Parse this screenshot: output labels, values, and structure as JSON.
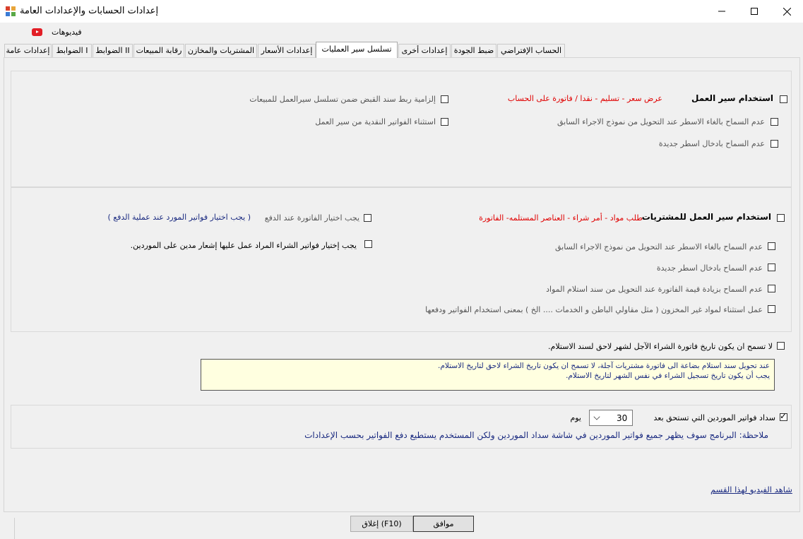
{
  "window": {
    "title": "إعدادات الحسابات والإعدادات العامة",
    "minimize_glyph": "—",
    "maximize_glyph": "☐",
    "close_glyph": "✕"
  },
  "videos_label": "فيديوهات",
  "tabs": [
    "إعدادات عامة",
    "الضوابط I",
    "الضوابط II",
    "رقابة المبيعات",
    "المشتريات والمخازن",
    "إعدادات الأسعار",
    "تسلسل سير العمليات",
    "إعدادات أخرى",
    "ضبط الجودة",
    "الحساب الإفتراضي"
  ],
  "active_tab": "تسلسل سير العمليات",
  "sales_workflow": {
    "use_workflow_label": "استخدام سير العمل",
    "sequence_text": "عرض سعر - تسليم - نقدا / فاتورة على الحساب",
    "no_cancel_lines_label": "عدم السماح بالغاء الاسطر عند التحويل من نموذج الاجراء السابق",
    "no_new_lines_label": "عدم السماح بادخال اسطر جديدة",
    "mandatory_receipt_label": "إلزامية ربط سند القبض ضمن تسلسل سيرالعمل للمبيعات",
    "exclude_cash_invoices_label": "استثناء الفواتير النقدية من سير العمل"
  },
  "purchase_workflow": {
    "use_workflow_label": "استخدام سير العمل للمشتريات",
    "sequence_text": "طلب مواد - أمر شراء - العناصر المستلمه- الفاتورة",
    "no_cancel_lines_label": "عدم السماح بالغاء الاسطر عند التحويل من نموذج الاجراء السابق",
    "no_new_lines_label": "عدم السماح بادخال اسطر جديدة",
    "no_increase_value_label": "عدم السماح بزيادة قيمة الفاتورة عند التحويل من سند استلام المواد",
    "exception_non_stock_label": "عمل استثناء لمواد غير المخزون ( مثل مقاولي الباطن و الخدمات .... الخ ) بمعنى استخدام الفواتير ودفعها",
    "must_select_invoice_label": "يجب اختيار الفاتورة عند الدفع",
    "must_select_invoice_note": "( يجب اختيار فواتير المورد عند عملية الدفع )",
    "must_select_debit_label": "يجب إختيار فواتير الشراء المراد عمل عليها إشعار مدين على الموردين."
  },
  "date_rule": {
    "label": "لا تسمح ان يكون تاريخ فاتورة الشراء الآجل لشهر لاحق لسند الاستلام.",
    "note_line1": "عند تحويل سند استلام بضاعة الى فاتورة مشتريات آجلة، لا تسمح ان يكون تاريخ الشراء لاحق لتاريخ الاستلام.",
    "note_line2": "يجب أن يكون تاريخ تسجيل الشراء في نفس الشهر لتاريخ الاستلام."
  },
  "supplier_payment": {
    "label": "سداد فواتير الموردين التي تستحق بعد",
    "days_value": "30",
    "days_unit": "يوم",
    "note": "ملاحظة: البرنامج سوف يظهر جميع فواتير الموردين في شاشة سداد الموردين ولكن المستخدم يستطيع دفع الفواتير بحسب الإعدادات"
  },
  "video_link": "شاهد الفيديو لهذا القسم",
  "buttons": {
    "ok": "موافق",
    "close": "إغلاق (F10)"
  }
}
